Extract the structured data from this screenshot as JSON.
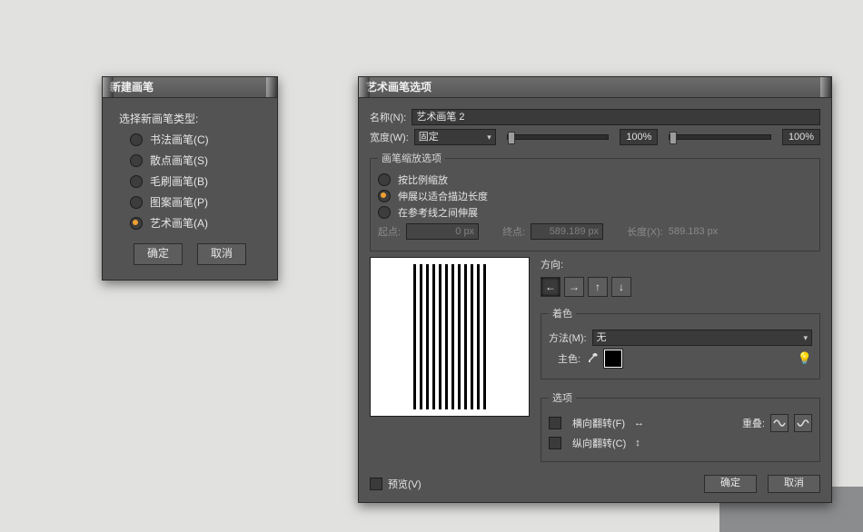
{
  "dlg1": {
    "title": "新建画笔",
    "group_label": "选择新画笔类型:",
    "options": [
      {
        "label": "书法画笔(C)",
        "checked": false
      },
      {
        "label": "散点画笔(S)",
        "checked": false
      },
      {
        "label": "毛刷画笔(B)",
        "checked": false
      },
      {
        "label": "图案画笔(P)",
        "checked": false
      },
      {
        "label": "艺术画笔(A)",
        "checked": true
      }
    ],
    "ok": "确定",
    "cancel": "取消"
  },
  "dlg2": {
    "title": "艺术画笔选项",
    "name_label": "名称(N):",
    "name_value": "艺术画笔 2",
    "width_label": "宽度(W):",
    "width_mode": "固定",
    "width_left_pct": "100%",
    "width_right_pct": "100%",
    "scale": {
      "legend": "画笔缩放选项",
      "opt_proportional": "按比例缩放",
      "opt_stretch": "伸展以适合描边长度",
      "opt_between_guides": "在参考线之间伸展",
      "start_label": "起点:",
      "start_value": "0 px",
      "end_label": "终点:",
      "end_value": "589.189 px",
      "length_label": "长度(X):",
      "length_value": "589.183 px",
      "selected": "stretch"
    },
    "direction": {
      "label": "方向:",
      "icons": [
        "←",
        "→",
        "↑",
        "↓"
      ],
      "selected": 0
    },
    "color": {
      "legend": "着色",
      "method_label": "方法(M):",
      "method_value": "无",
      "key_label": "主色:",
      "swatch": "#000000"
    },
    "options": {
      "legend": "选项",
      "flip_h": "横向翻转(F)",
      "flip_v": "纵向翻转(C)",
      "overlap_label": "重叠:",
      "flip_h_checked": false,
      "flip_v_checked": false
    },
    "footer": {
      "preview": "预览(V)",
      "ok": "确定",
      "cancel": "取消"
    }
  }
}
